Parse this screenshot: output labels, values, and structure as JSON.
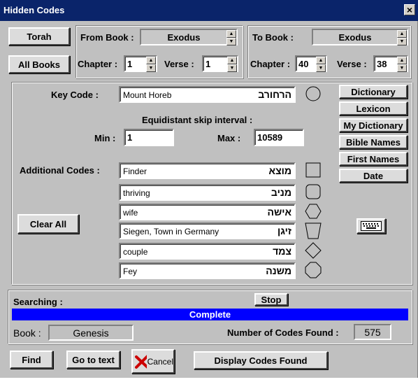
{
  "window": {
    "title": "Hidden Codes"
  },
  "top": {
    "torah_button": "Torah",
    "all_books_button": "All Books",
    "from_book_label": "From Book :",
    "from_book_value": "Exodus",
    "from_chapter_label": "Chapter :",
    "from_chapter_value": "1",
    "from_verse_label": "Verse :",
    "from_verse_value": "1",
    "to_book_label": "To Book :",
    "to_book_value": "Exodus",
    "to_chapter_label": "Chapter :",
    "to_chapter_value": "40",
    "to_verse_label": "Verse :",
    "to_verse_value": "38"
  },
  "codes": {
    "key_code_label": "Key Code :",
    "key_code_en": "Mount Horeb",
    "key_code_he": "הרחורב",
    "skip_label": "Equidistant skip interval :",
    "min_label": "Min :",
    "min_value": "1",
    "max_label": "Max :",
    "max_value": "10589",
    "additional_label": "Additional Codes :",
    "clear_all_button": "Clear All",
    "additional": [
      {
        "en": "Finder",
        "he": "מוצא",
        "shape": "square-icon"
      },
      {
        "en": "thriving",
        "he": "מניב",
        "shape": "rounded-square-icon"
      },
      {
        "en": "wife",
        "he": "אישה",
        "shape": "hexagon-icon"
      },
      {
        "en": "Siegen, Town in Germany",
        "he": "זיגן",
        "shape": "trapezoid-icon"
      },
      {
        "en": "couple",
        "he": "צמד",
        "shape": "diamond-icon"
      },
      {
        "en": " Fey",
        "he": "משנה",
        "shape": "octagon-icon"
      }
    ]
  },
  "side_buttons": {
    "dictionary": "Dictionary",
    "lexicon": "Lexicon",
    "my_dictionary": "My Dictionary",
    "bible_names": "Bible Names",
    "first_names": "First Names",
    "date": "Date"
  },
  "search": {
    "searching_label": "Searching :",
    "stop_button": "Stop",
    "progress_text": "Complete",
    "progress_fraction": 1,
    "book_label": "Book :",
    "book_value": "Genesis",
    "found_label": "Number of Codes Found :",
    "found_value": "575"
  },
  "bottom": {
    "find_button": "Find",
    "goto_button": "Go to text",
    "cancel_button": "Cancel",
    "display_button": "Display Codes Found"
  },
  "colors": {
    "titlebar": "#0a246a",
    "face": "#c0c0c0",
    "progress": "#0000ff",
    "cancel_x": "#cc0000"
  }
}
